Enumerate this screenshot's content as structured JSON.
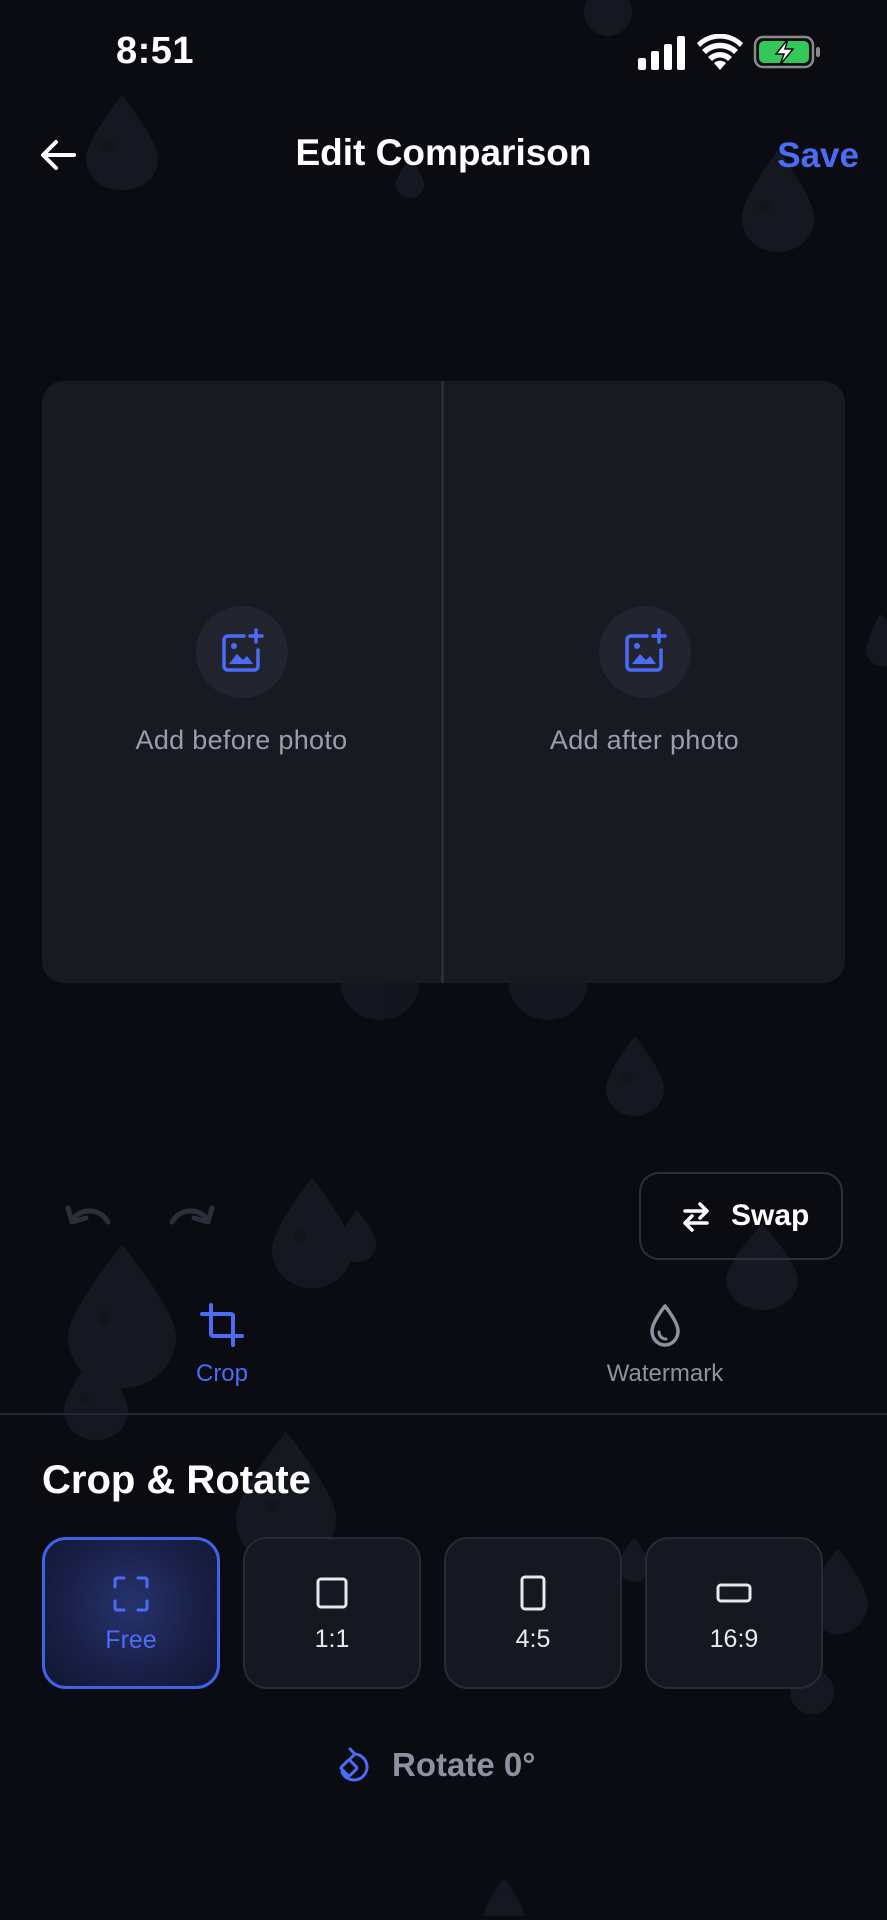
{
  "status_bar": {
    "time": "8:51"
  },
  "header": {
    "title": "Edit Comparison",
    "save_label": "Save"
  },
  "compare": {
    "before_label": "Add before photo",
    "after_label": "Add after photo"
  },
  "actions": {
    "swap_label": "Swap"
  },
  "tools": {
    "crop_label": "Crop",
    "watermark_label": "Watermark",
    "active": "Crop"
  },
  "crop_section": {
    "title": "Crop & Rotate",
    "ratios": [
      {
        "label": "Free",
        "icon": "free-crop-icon",
        "selected": true
      },
      {
        "label": "1:1",
        "icon": "square-icon",
        "selected": false
      },
      {
        "label": "4:5",
        "icon": "portrait-icon",
        "selected": false
      },
      {
        "label": "16:9",
        "icon": "landscape-icon",
        "selected": false
      }
    ],
    "rotate_label": "Rotate 0°"
  },
  "colors": {
    "accent": "#4a6cf7",
    "background": "#0b0c11",
    "panel": "#181a22",
    "muted_text": "#8e92a0",
    "battery_green": "#34c759"
  }
}
